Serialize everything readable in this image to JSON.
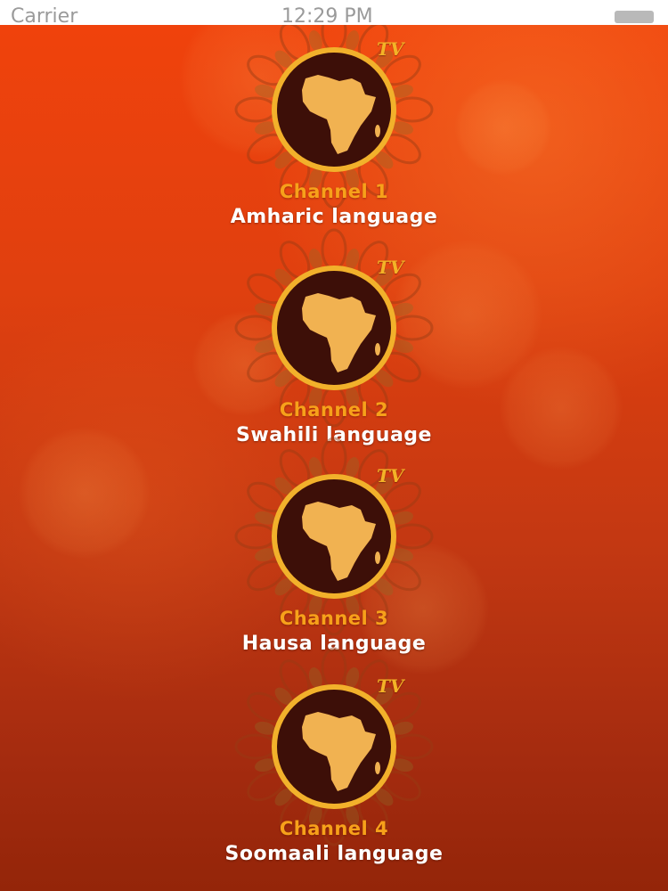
{
  "status_bar": {
    "carrier": "Carrier",
    "time": "12:29 PM"
  },
  "channels": [
    {
      "label": "Channel 1",
      "language": "Amharic language",
      "badge": "TV",
      "icon": "africa-map-icon"
    },
    {
      "label": "Channel 2",
      "language": "Swahili language",
      "badge": "TV",
      "icon": "africa-map-icon"
    },
    {
      "label": "Channel 3",
      "language": "Hausa language",
      "badge": "TV",
      "icon": "africa-map-icon"
    },
    {
      "label": "Channel 4",
      "language": "Soomaali language",
      "badge": "TV",
      "icon": "africa-map-icon"
    }
  ],
  "colors": {
    "background_top": "#f0420c",
    "background_bottom": "#942509",
    "channel_label": "#f7a11a",
    "language_label": "#ffffff",
    "logo_ring": "#f2b12b",
    "logo_disc": "#3d0f08"
  }
}
